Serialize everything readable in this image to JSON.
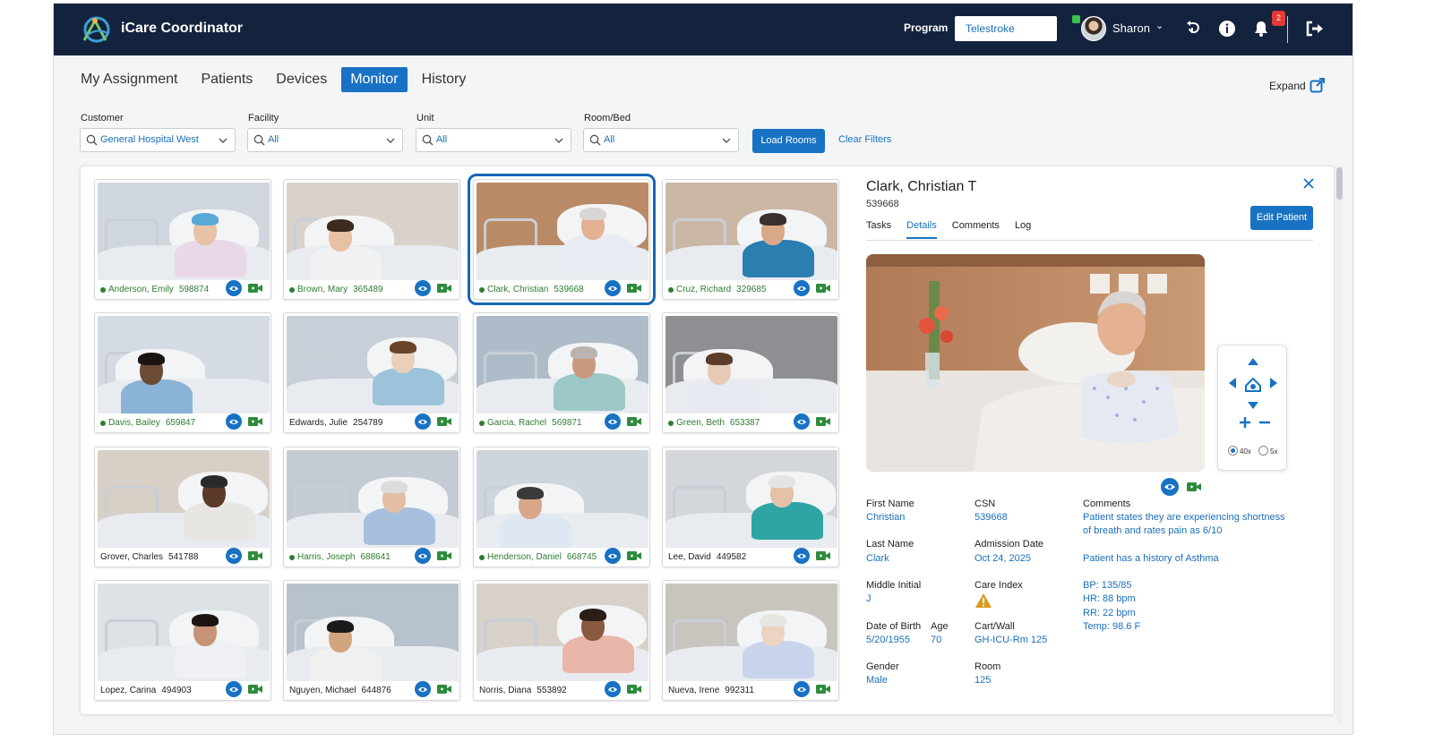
{
  "app": {
    "title": "iCare Coordinator"
  },
  "header": {
    "program_label": "Program",
    "program_value": "Telestroke",
    "user_name": "Sharon",
    "notification_count": "2"
  },
  "nav": {
    "tabs": [
      {
        "label": "My Assignment",
        "active": false
      },
      {
        "label": "Patients",
        "active": false
      },
      {
        "label": "Devices",
        "active": false
      },
      {
        "label": "Monitor",
        "active": true
      },
      {
        "label": "History",
        "active": false
      }
    ],
    "expand_label": "Expand"
  },
  "filters": {
    "customer": {
      "label": "Customer",
      "value": "General Hospital West"
    },
    "facility": {
      "label": "Facility",
      "value": "All"
    },
    "unit": {
      "label": "Unit",
      "value": "All"
    },
    "room_bed": {
      "label": "Room/Bed",
      "value": "All"
    },
    "load_button": "Load Rooms",
    "clear_button": "Clear Filters"
  },
  "tiles": [
    {
      "name": "Anderson, Emily",
      "id": "598874",
      "live": true
    },
    {
      "name": "Brown, Mary",
      "id": "365489",
      "live": true
    },
    {
      "name": "Clark, Christian",
      "id": "539668",
      "live": true,
      "selected": true
    },
    {
      "name": "Cruz, Richard",
      "id": "329685",
      "live": true
    },
    {
      "name": "Davis, Bailey",
      "id": "659847",
      "live": true
    },
    {
      "name": "Edwards, Julie",
      "id": "254789",
      "live": false
    },
    {
      "name": "Garcia, Rachel",
      "id": "569871",
      "live": true
    },
    {
      "name": "Green, Beth",
      "id": "653387",
      "live": true
    },
    {
      "name": "Grover, Charles",
      "id": "541788",
      "live": false
    },
    {
      "name": "Harris, Joseph",
      "id": "688641",
      "live": true
    },
    {
      "name": "Henderson, Daniel",
      "id": "668745",
      "live": true
    },
    {
      "name": "Lee, David",
      "id": "449582",
      "live": false
    },
    {
      "name": "Lopez, Carina",
      "id": "494903",
      "live": false
    },
    {
      "name": "Nguyen, Michael",
      "id": "644876",
      "live": false
    },
    {
      "name": "Norris, Diana",
      "id": "553892",
      "live": false
    },
    {
      "name": "Nueva, Irene",
      "id": "992311",
      "live": false
    }
  ],
  "detail": {
    "name": "Clark, Christian T",
    "id": "539668",
    "edit_button": "Edit Patient",
    "tabs": [
      {
        "label": "Tasks",
        "active": false
      },
      {
        "label": "Details",
        "active": true
      },
      {
        "label": "Comments",
        "active": false
      },
      {
        "label": "Log",
        "active": false
      }
    ],
    "zoom_options": [
      "40x",
      "5x"
    ],
    "fields": {
      "first_name": {
        "label": "First Name",
        "value": "Christian"
      },
      "csn": {
        "label": "CSN",
        "value": "539668"
      },
      "last_name": {
        "label": "Last Name",
        "value": "Clark"
      },
      "admission_date": {
        "label": "Admission Date",
        "value": "Oct 24, 2025"
      },
      "middle_initial": {
        "label": "Middle Initial",
        "value": "J"
      },
      "care_index": {
        "label": "Care Index"
      },
      "dob": {
        "label": "Date of Birth",
        "value": "5/20/1955"
      },
      "age": {
        "label": "Age",
        "value": "70"
      },
      "cart_wall": {
        "label": "Cart/Wall",
        "value": "GH-ICU-Rm 125"
      },
      "gender": {
        "label": "Gender",
        "value": "Male"
      },
      "room": {
        "label": "Room",
        "value": "125"
      }
    },
    "comments": {
      "label": "Comments",
      "line1": "Patient states they are experiencing shortness",
      "line2": "of breath and rates pain as 6/10",
      "history": "Patient has a history of Asthma",
      "bp": "BP: 135/85",
      "hr": "HR: 88 bpm",
      "rr": "RR: 22 bpm",
      "temp": "Temp: 98.6 F"
    }
  }
}
